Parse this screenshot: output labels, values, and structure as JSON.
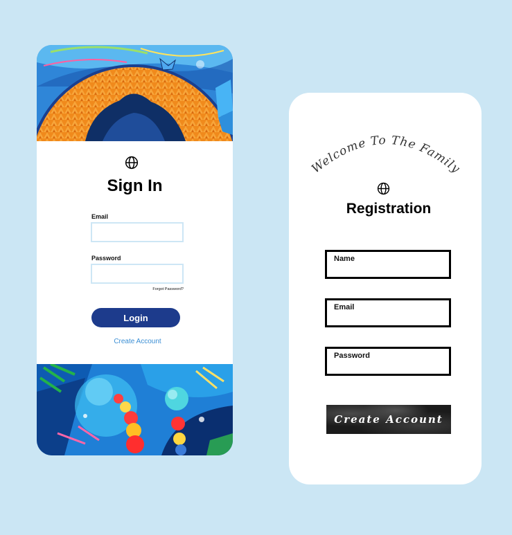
{
  "signin": {
    "title": "Sign In",
    "email_label": "Email",
    "email_value": "",
    "password_label": "Password",
    "password_value": "",
    "forgot_label": "Forgot Password?",
    "login_label": "Login",
    "create_account_label": "Create Account",
    "globe_icon": "globe-icon"
  },
  "register": {
    "welcome": "Welcome To The Family",
    "title": "Registration",
    "name_label": "Name",
    "email_label": "Email",
    "password_label": "Password",
    "create_label": "Create Account",
    "globe_icon": "globe-icon"
  },
  "colors": {
    "background": "#cbe6f4",
    "login_button": "#1d3b8c",
    "create_link": "#3a8ed4",
    "input_border": "#cde6f5",
    "create_button": "#1b1b1b"
  }
}
